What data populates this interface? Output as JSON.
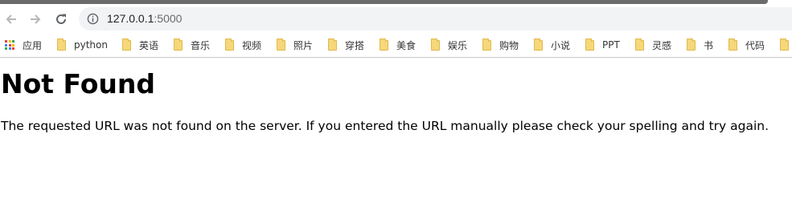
{
  "browser": {
    "url_host": "127.0.0.1",
    "url_port": ":5000",
    "icons": [
      "back-arrow",
      "forward-arrow",
      "reload",
      "site-info"
    ]
  },
  "bookmarks": {
    "apps_label": "应用",
    "folders": [
      "python",
      "英语",
      "音乐",
      "视频",
      "照片",
      "穿搭",
      "美食",
      "娱乐",
      "购物",
      "小说",
      "PPT",
      "灵感",
      "书",
      "代码"
    ]
  },
  "page": {
    "heading": "Not Found",
    "message": "The requested URL was not found on the server. If you entered the URL manually please check your spelling and try again."
  }
}
